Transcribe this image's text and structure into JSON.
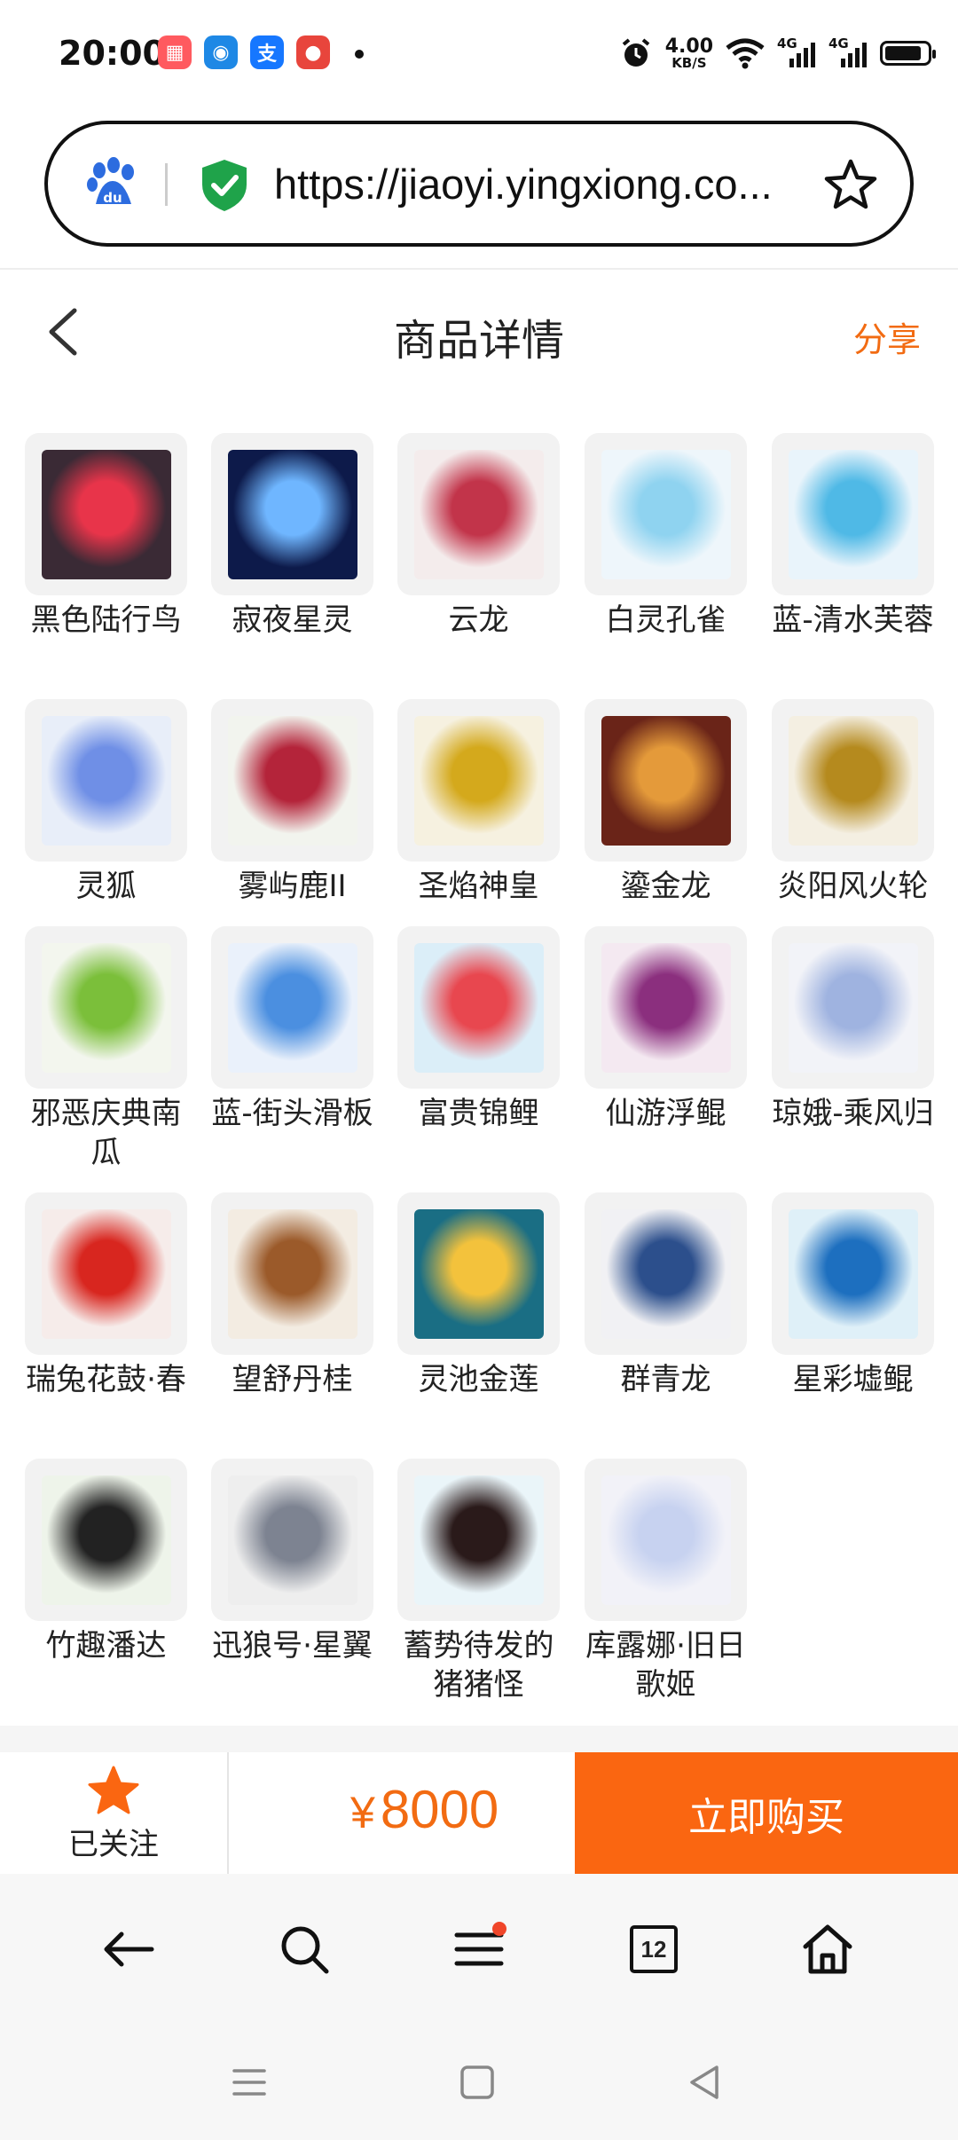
{
  "status_bar": {
    "time": "20:00",
    "apps": [
      {
        "icon": "bento-app-icon",
        "color": "#ff5a5f"
      },
      {
        "icon": "robot-app-icon",
        "color": "#1e88e5"
      },
      {
        "icon": "alipay-icon",
        "color": "#1677ff"
      },
      {
        "icon": "lantern-app-icon",
        "color": "#e8453c"
      }
    ],
    "speed_value": "4.00",
    "speed_unit": "KB/S",
    "network_1": "4G",
    "network_2": "4G"
  },
  "browser": {
    "url": "https://jiaoyi.yingxiong.co..."
  },
  "header": {
    "title": "商品详情",
    "share": "分享"
  },
  "items": [
    {
      "name": "黑色陆行鸟",
      "color": "#3a2a35",
      "accent": "#e8344a"
    },
    {
      "name": "寂夜星灵",
      "color": "#0d1a4a",
      "accent": "#6fb6ff"
    },
    {
      "name": "云龙",
      "color": "#f4ecec",
      "accent": "#c2344a"
    },
    {
      "name": "白灵孔雀",
      "color": "#eef6fb",
      "accent": "#8fd3f0"
    },
    {
      "name": "蓝-清水芙蓉",
      "color": "#e9f4fb",
      "accent": "#4fb9e6"
    },
    {
      "name": "灵狐",
      "color": "#e8eef9",
      "accent": "#6f8fe6"
    },
    {
      "name": "雾屿鹿II",
      "color": "#f2f4ee",
      "accent": "#b4243a"
    },
    {
      "name": "圣焰神皇",
      "color": "#f6f1e0",
      "accent": "#d4a91c"
    },
    {
      "name": "鎏金龙",
      "color": "#6a2418",
      "accent": "#e49a3a"
    },
    {
      "name": "炎阳风火轮",
      "color": "#f4efe2",
      "accent": "#b58a1e"
    },
    {
      "name": "邪恶庆典南瓜",
      "color": "#f3f6ee",
      "accent": "#7bbf3a"
    },
    {
      "name": "蓝-街头滑板",
      "color": "#eaf1fb",
      "accent": "#4b8fe0"
    },
    {
      "name": "富贵锦鲤",
      "color": "#dbeef8",
      "accent": "#e8474f"
    },
    {
      "name": "仙游浮鲲",
      "color": "#f4e9f1",
      "accent": "#8b2f7e"
    },
    {
      "name": "琼娥-乘风归",
      "color": "#f2f3f8",
      "accent": "#9fb3e0"
    },
    {
      "name": "瑞兔花鼓·春",
      "color": "#f6ecea",
      "accent": "#d8261f"
    },
    {
      "name": "望舒丹桂",
      "color": "#f3ece2",
      "accent": "#9b5a2a"
    },
    {
      "name": "灵池金莲",
      "color": "#1a6e84",
      "accent": "#f3c23c"
    },
    {
      "name": "群青龙",
      "color": "#f1f1f4",
      "accent": "#2c4f8c"
    },
    {
      "name": "星彩墟鲲",
      "color": "#dff0f8",
      "accent": "#1d6fbf"
    },
    {
      "name": "竹趣潘达",
      "color": "#eef4ea",
      "accent": "#222222"
    },
    {
      "name": "迅狼号·星翼",
      "color": "#eeeeee",
      "accent": "#7d8391"
    },
    {
      "name": "蓄势待发的猪猪怪",
      "color": "#eaf5f9",
      "accent": "#2a1a1a"
    },
    {
      "name": "库露娜·旧日歌姬",
      "color": "#f2f2f8",
      "accent": "#c7d2f0"
    }
  ],
  "action_bar": {
    "follow_label": "已关注",
    "currency": "¥",
    "price": "8000",
    "buy_label": "立即购买"
  },
  "browser_nav": {
    "tab_count": "12"
  },
  "colors": {
    "accent_orange": "#fa6611",
    "share_orange": "#f26b12"
  }
}
